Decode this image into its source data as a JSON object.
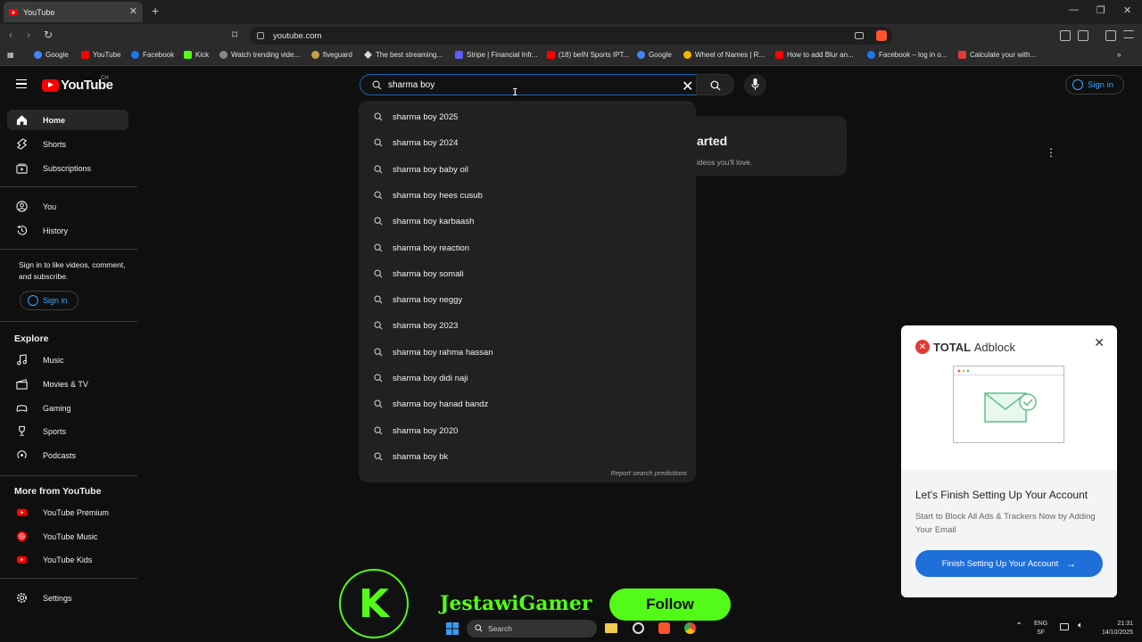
{
  "browser": {
    "tab_title": "YouTube",
    "address": "youtube.com",
    "bookmarks": [
      {
        "label": "Google",
        "color": "#4285f4"
      },
      {
        "label": "YouTube",
        "color": "#ff0000"
      },
      {
        "label": "Facebook",
        "color": "#1877f2"
      },
      {
        "label": "Kick",
        "color": "#53fc18"
      },
      {
        "label": "Watch trending vide...",
        "color": "#888888"
      },
      {
        "label": "fiveguard",
        "color": "#c9a24a"
      },
      {
        "label": "The best streaming...",
        "color": "#dddddd"
      },
      {
        "label": "Stripe | Financial Infr...",
        "color": "#635bff"
      },
      {
        "label": "(18) beIN Sports IPT...",
        "color": "#ff0000"
      },
      {
        "label": "Google",
        "color": "#4285f4"
      },
      {
        "label": "Wheel of Names | R...",
        "color": "#f4b400"
      },
      {
        "label": "How to add Blur an...",
        "color": "#ff0000"
      },
      {
        "label": "Facebook – log in o...",
        "color": "#1877f2"
      },
      {
        "label": "Calculate your with...",
        "color": "#e53935"
      }
    ]
  },
  "youtube": {
    "logo_text": "YouTube",
    "region": "CH",
    "search_value": "sharma boy",
    "signin_label": "Sign in"
  },
  "sidebar": {
    "primary": [
      "Home",
      "Shorts",
      "Subscriptions"
    ],
    "you": [
      "You",
      "History"
    ],
    "signin_note": "Sign in to like videos, comment, and subscribe.",
    "signin_button": "Sign in",
    "explore_heading": "Explore",
    "explore": [
      "Music",
      "Movies & TV",
      "Gaming",
      "Sports",
      "Podcasts"
    ],
    "more_heading": "More from YouTube",
    "more": [
      "YouTube Premium",
      "YouTube Music",
      "YouTube Kids"
    ],
    "settings": "Settings"
  },
  "card": {
    "title": "arted",
    "subtitle": "ideos you'll love."
  },
  "suggestions": [
    "sharma boy 2025",
    "sharma boy 2024",
    "sharma boy baby oil",
    "sharma boy hees cusub",
    "sharma boy karbaash",
    "sharma boy reaction",
    "sharma boy somali",
    "sharma boy neggy",
    "sharma boy 2023",
    "sharma boy rahma hassan",
    "sharma boy didi naji",
    "sharma boy hanad bandz",
    "sharma boy 2020",
    "sharma boy bk"
  ],
  "report_label": "Report search predictions",
  "adblock": {
    "brand_bold": "TOTAL",
    "brand_rest": "Adblock",
    "title": "Let's Finish Setting Up Your Account",
    "text": "Start to Block All Ads & Trackers Now by Adding Your Email",
    "button": "Finish Setting Up Your Account"
  },
  "kick": {
    "badge": "K",
    "name": "JestawiGamer",
    "follow": "Follow"
  },
  "taskbar": {
    "search_placeholder": "Search",
    "lang_top": "ENG",
    "lang_bottom": "SF",
    "time": "21:31",
    "date": "14/10/2025"
  }
}
